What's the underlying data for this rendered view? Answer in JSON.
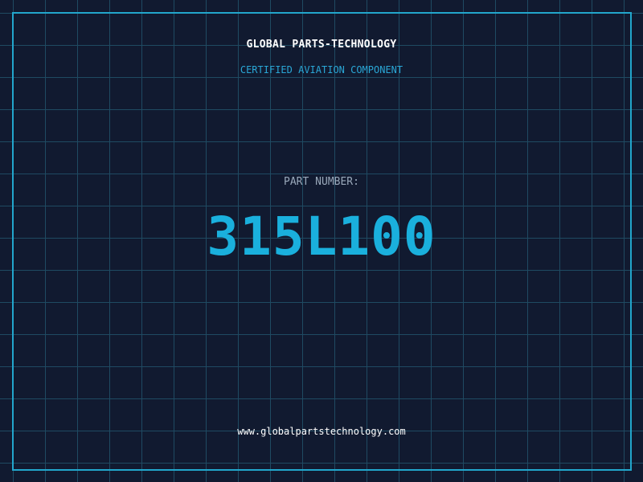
{
  "brand": {
    "title": "GLOBAL PARTS-TECHNOLOGY",
    "subtitle": "CERTIFIED AVIATION COMPONENT"
  },
  "part": {
    "label": "PART NUMBER:",
    "number": "315L100"
  },
  "footer": {
    "website": "www.globalpartstechnology.com"
  },
  "colors": {
    "background": "#111a30",
    "grid": "#1f4a62",
    "accent": "#22a6cc",
    "part_number": "#1ab0dd"
  }
}
